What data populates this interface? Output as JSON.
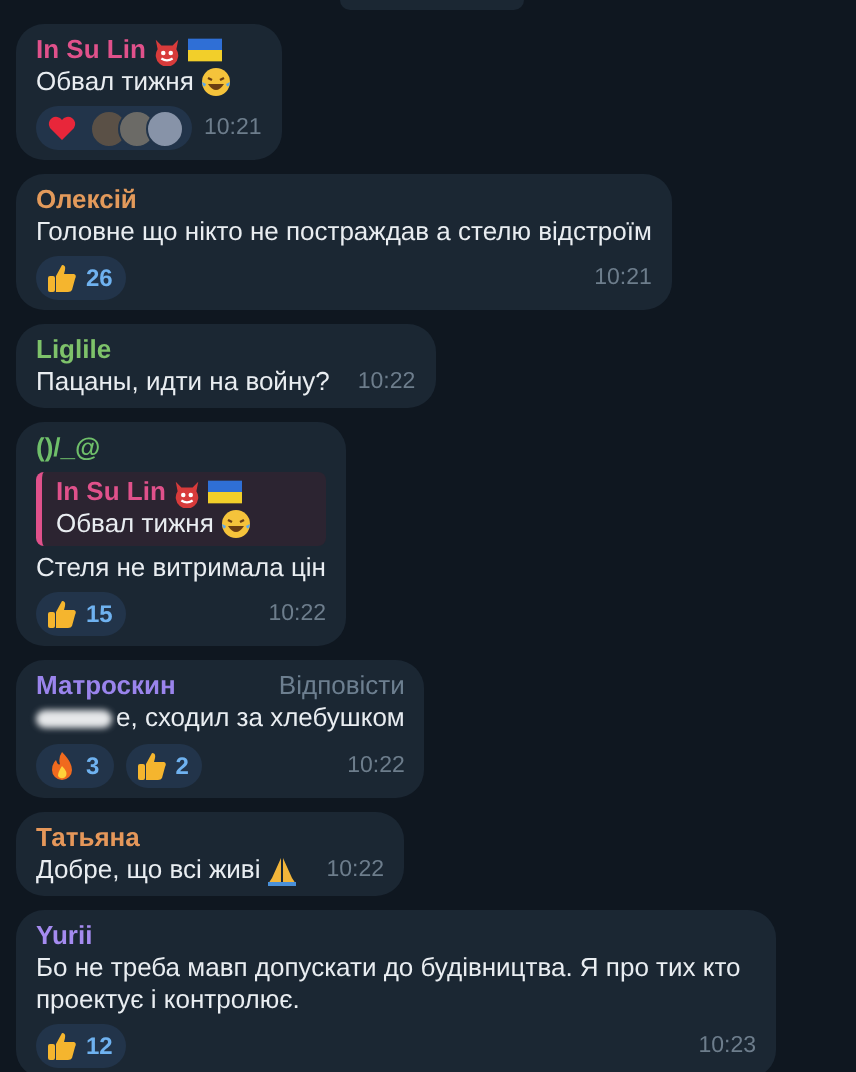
{
  "messages": [
    {
      "author": "In Su Lin",
      "color": "#e0518b",
      "badges": [
        {
          "kind": "devil"
        },
        {
          "kind": "flag"
        }
      ],
      "text": "Обвал тижня",
      "text_icon": {
        "kind": "laughing"
      },
      "time": "10:21",
      "reactions": [
        {
          "kind": "reactors"
        }
      ]
    },
    {
      "author": "Олексій",
      "color": "#e39a5b",
      "text": "Головне що нікто не постраждав а стелю відстроїм",
      "time": "10:21",
      "reactions": [
        {
          "kind": "like",
          "count": "26"
        }
      ]
    },
    {
      "author": "Liglile",
      "color": "#7ec26a",
      "text": "Пацаны, идти на войну?",
      "time": "10:22"
    },
    {
      "author": "()/_@",
      "color": "#6fbf6a",
      "reply": {
        "author": "In Su Lin",
        "badges": [
          {
            "kind": "devil"
          },
          {
            "kind": "flag"
          }
        ],
        "text": "Обвал тижня",
        "text_icon": {
          "kind": "laughing"
        }
      },
      "text": "Стеля не витримала цін",
      "time": "10:22",
      "reactions": [
        {
          "kind": "like",
          "count": "15"
        }
      ]
    },
    {
      "author": "Матроскин",
      "color": "#9a84ec",
      "action": "Відповісти",
      "redacted": true,
      "text": "е, сходил за хлебушком",
      "time": "10:22",
      "reactions": [
        {
          "kind": "fire",
          "count": "3"
        },
        {
          "kind": "like",
          "count": "2"
        }
      ]
    },
    {
      "author": "Татьяна",
      "color": "#e5975a",
      "text": "Добре, що всі живі",
      "text_icon": {
        "kind": "pray"
      },
      "time": "10:22"
    },
    {
      "author": "Yurii",
      "color": "#a58bf0",
      "text": "Бо не треба мавп допускати до будівництва. Я про тих кто проектує і контролює.",
      "time": "10:23",
      "reactions": [
        {
          "kind": "like",
          "count": "12"
        }
      ]
    }
  ]
}
